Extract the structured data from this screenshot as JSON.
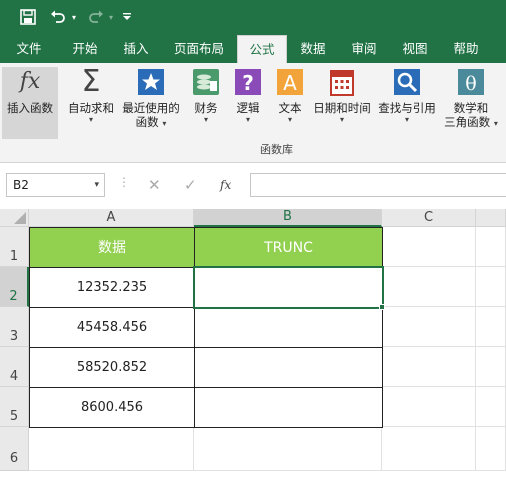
{
  "quick_access": {
    "save_icon": "save-icon",
    "undo_icon": "undo-icon",
    "redo_icon": "redo-icon",
    "customize_icon": "customize-icon"
  },
  "tabs": [
    {
      "label": "文件"
    },
    {
      "label": "开始"
    },
    {
      "label": "插入"
    },
    {
      "label": "页面布局"
    },
    {
      "label": "公式",
      "active": true
    },
    {
      "label": "数据"
    },
    {
      "label": "审阅"
    },
    {
      "label": "视图"
    },
    {
      "label": "帮助"
    }
  ],
  "ribbon": {
    "insert_function": "插入函数",
    "autosum": "自动求和",
    "recent_1": "最近使用的",
    "recent_2": "函数",
    "financial": "财务",
    "logical": "逻辑",
    "text": "文本",
    "datetime": "日期和时间",
    "lookup": "查找与引用",
    "math_1": "数学和",
    "math_2": "三角函数",
    "group_label": "函数库"
  },
  "formula_bar": {
    "name_box": "B2",
    "fx": "fx",
    "formula": ""
  },
  "sheet": {
    "columns": [
      "A",
      "B",
      "C"
    ],
    "rows": [
      "1",
      "2",
      "3",
      "4",
      "5",
      "6"
    ],
    "header_a": "数据",
    "header_b": "TRUNC",
    "values": [
      "12352.235",
      "45458.456",
      "58520.852",
      "8600.456"
    ]
  },
  "colors": {
    "excel_green": "#217346",
    "header_fill": "#92d050"
  }
}
